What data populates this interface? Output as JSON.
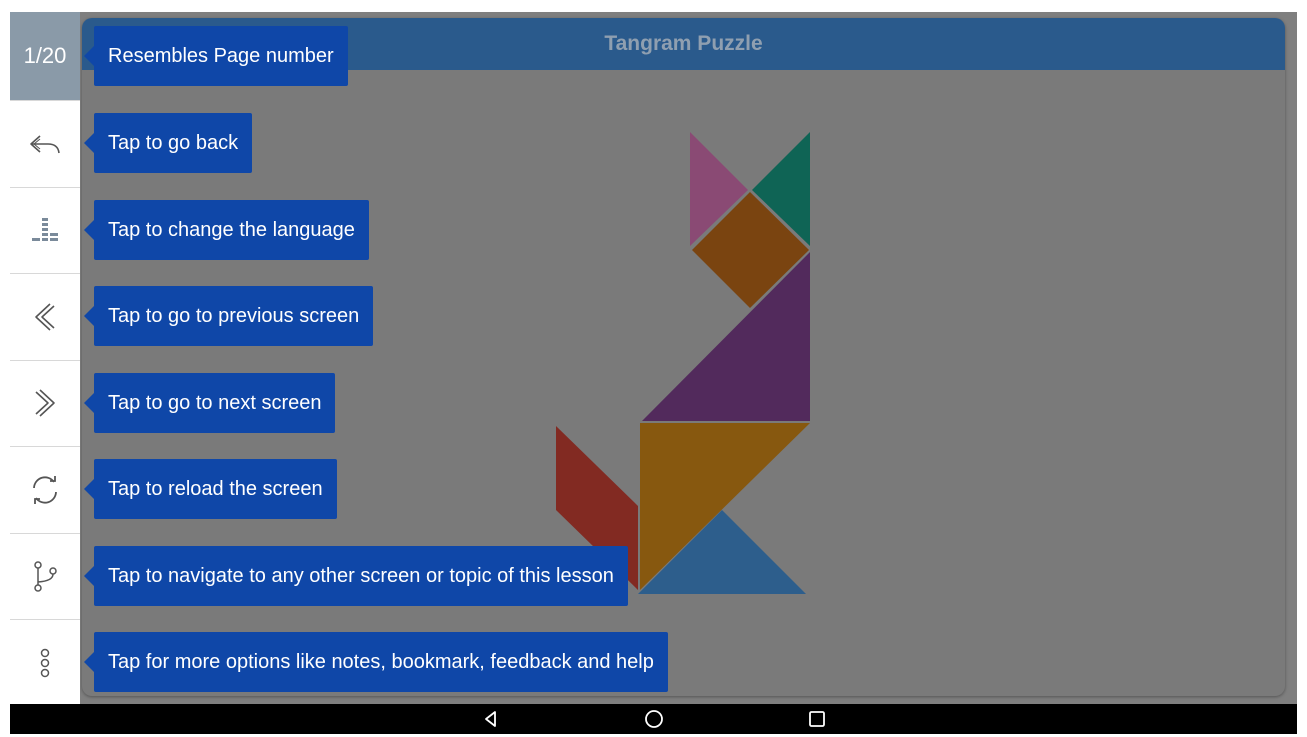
{
  "app": {
    "title": "Tangram Puzzle",
    "page_number": "1/20"
  },
  "sidebar": {
    "items": [
      {
        "icon": "back-arrow-icon",
        "tooltip": "Tap to go back"
      },
      {
        "icon": "language-icon",
        "tooltip": "Tap to change the language"
      },
      {
        "icon": "chevron-left-icon",
        "tooltip": "Tap to go to previous screen"
      },
      {
        "icon": "chevron-right-icon",
        "tooltip": "Tap to go to next screen"
      },
      {
        "icon": "reload-icon",
        "tooltip": "Tap to reload the screen"
      },
      {
        "icon": "navigate-icon",
        "tooltip": "Tap to navigate to any other screen or topic of this lesson"
      },
      {
        "icon": "more-options-icon",
        "tooltip": "Tap for more options like notes, bookmark, feedback and help"
      }
    ],
    "page_number_tooltip": "Resembles Page number"
  },
  "navbar": {
    "icons": [
      "nav-back-icon",
      "nav-home-icon",
      "nav-recents-icon"
    ]
  },
  "colors": {
    "tooltip_bg": "#0f47a8",
    "title_bar": "#2a5a8c",
    "overlay": "#7f7f7f",
    "pink_triangle": "#8a4a74",
    "green_triangle": "#0f6455",
    "square": "#7a4410",
    "purple_triangle": "#522a5c",
    "orange_triangle": "#87580f",
    "red_parallelogram": "#822a22",
    "blue_triangle": "#2d5e8c"
  }
}
